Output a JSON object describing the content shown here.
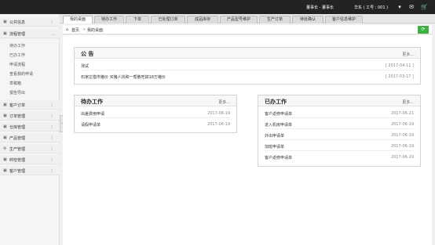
{
  "topbar": {
    "user": "董事长 - 董事长",
    "account": "华东 ( 工号 : 001 )",
    "chevron": "▾",
    "mail_icon": "✉",
    "cart_icon": "🛒"
  },
  "sidebar": {
    "sections": [
      {
        "label": "公共信息",
        "icon": "▣",
        "chevron": "〉"
      },
      {
        "label": "流程管理",
        "icon": "▣",
        "chevron": "︿"
      },
      {
        "label": "客户订单",
        "icon": "▣",
        "chevron": "〉"
      },
      {
        "label": "订单管理",
        "icon": "▣",
        "chevron": "〉"
      },
      {
        "label": "仓库管理",
        "icon": "▣",
        "chevron": "〉"
      },
      {
        "label": "产品管理",
        "icon": "▣",
        "chevron": "〉"
      },
      {
        "label": "生产管理",
        "icon": "⚙",
        "chevron": "〉"
      },
      {
        "label": "终检管理",
        "icon": "▣",
        "chevron": "〉"
      },
      {
        "label": "客户管理",
        "icon": "▣",
        "chevron": "〉"
      }
    ],
    "sub_items": [
      "待办工作",
      "已办工作",
      "申请流程",
      "查看我的申请",
      "草稿箱",
      "报告导出"
    ]
  },
  "tabs": [
    "我的桌面",
    "待办工作",
    "下单",
    "已处理订单",
    "成品库存",
    "产品型号维护",
    "生产订单",
    "待处确认",
    "客户信息维护"
  ],
  "breadcrumb": {
    "home_icon": "⌂",
    "home": "首页",
    "sep": ">",
    "current": "我的桌面"
  },
  "refresh_icon": "⟳",
  "collapse_icon": "‹",
  "announcement": {
    "title": "公 告",
    "more": "更多...",
    "items": [
      {
        "text": "测试",
        "date": "[ 2017-04-11 ]"
      },
      {
        "text": "石家庄猎市猪价 买猪人找和一帮散吃掉18万猪价",
        "date": "[ 2017-03-17 ]"
      }
    ]
  },
  "todo": {
    "title": "待办工作",
    "more": "更多...",
    "items": [
      {
        "text": "出差费用申请",
        "date": "2017-06-19"
      },
      {
        "text": "请假申请单",
        "date": "2017-06-19"
      }
    ]
  },
  "done": {
    "title": "已办工作",
    "more": "更多...",
    "items": [
      {
        "text": "客户返修申请单",
        "date": "2017-06-21"
      },
      {
        "text": "进入机房申请单",
        "date": "2017-06-19"
      },
      {
        "text": "外出申请单",
        "date": "2017-06-19"
      },
      {
        "text": "加班申请单",
        "date": "2017-06-19"
      },
      {
        "text": "客户返修申请单",
        "date": "2017-06-19"
      }
    ]
  }
}
